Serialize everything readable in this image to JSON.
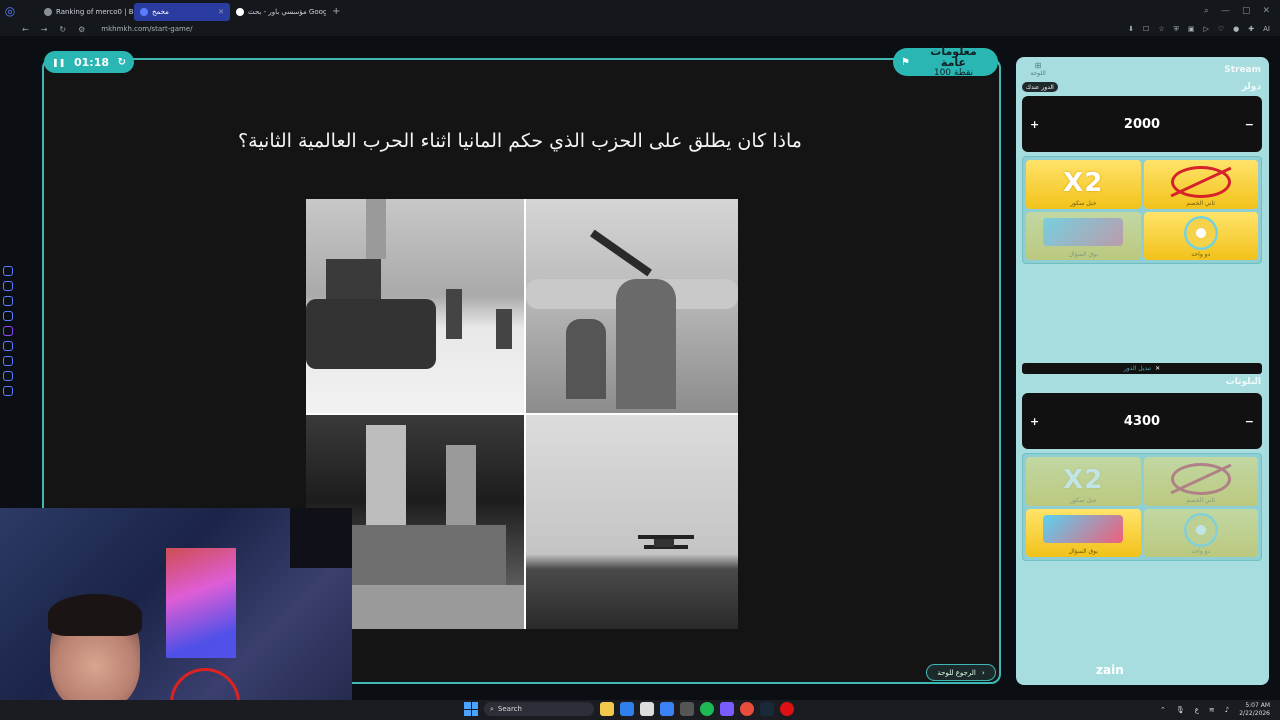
{
  "browser": {
    "tabs": [
      {
        "label": "Ranking of merco0 | BotR",
        "active": false
      },
      {
        "label": "مخمخ",
        "active": true
      },
      {
        "label": "مؤسسي باور - بحث Google",
        "active": false
      }
    ],
    "url": "mkhmkh.com/start-game/",
    "ai_label": "AI"
  },
  "game": {
    "timer": "01:18",
    "category": {
      "name": "معلومات عامة",
      "points": "100 نقطة"
    },
    "question": "ماذا كان يطلق على الحزب الذي حكم المانيا اثناء الحرب العالمية الثانية؟",
    "back_label": "الرجوع للوحة"
  },
  "panel": {
    "stream_label": "Stream",
    "board_label": "اللوحة",
    "teams": [
      {
        "name": "دولز",
        "turn_label": "الدور عندك",
        "score": "2000",
        "cards": [
          {
            "icon": "x2-icon",
            "label": "جبل سكور"
          },
          {
            "icon": "no-answer-icon",
            "label": "ثاني الخصم"
          },
          {
            "icon": "cards-icon",
            "label": "بوق السؤال"
          },
          {
            "icon": "wheel-icon",
            "label": "دو واحد"
          }
        ]
      },
      {
        "name": "البلوتات",
        "score": "4300",
        "cards": [
          {
            "icon": "x2-icon",
            "label": "جبل سكور"
          },
          {
            "icon": "no-answer-icon",
            "label": "ثاني الخصم"
          },
          {
            "icon": "cards-icon",
            "label": "بوق السؤال"
          },
          {
            "icon": "wheel-icon",
            "label": "دو واحد"
          }
        ]
      }
    ],
    "swap_turn_label": "تبديل الدور",
    "brand": "zain"
  },
  "taskbar": {
    "search_placeholder": "Search",
    "time": "5:07 AM",
    "date": "2/22/2026"
  },
  "colors": {
    "accent": "#2ab7b3",
    "panel": "#a8dde0",
    "stage": "#141414"
  }
}
